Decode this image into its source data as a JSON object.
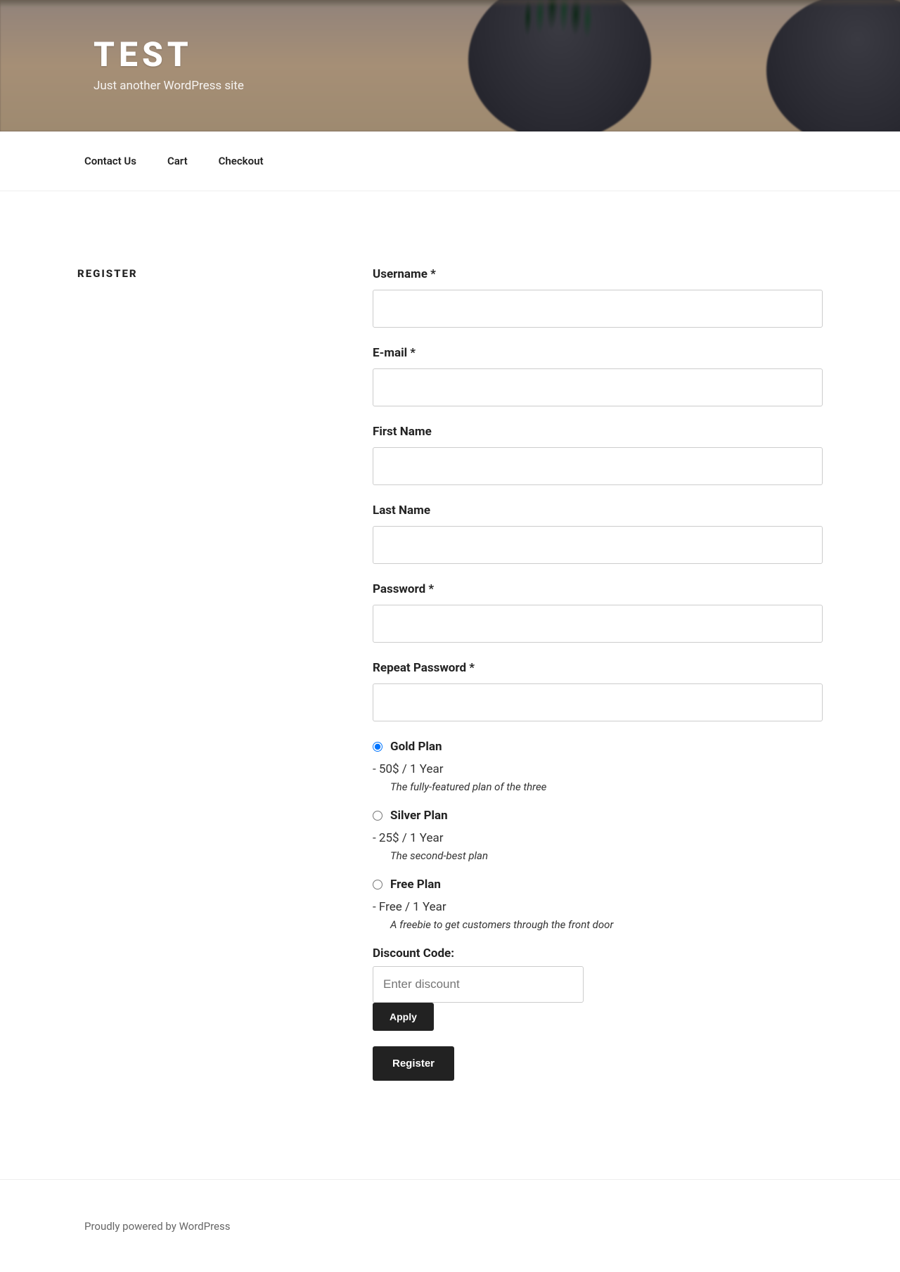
{
  "header": {
    "site_title": "TEST",
    "tagline": "Just another WordPress site"
  },
  "nav": {
    "items": [
      "Contact Us",
      "Cart",
      "Checkout"
    ]
  },
  "page": {
    "title": "REGISTER"
  },
  "form": {
    "username_label": "Username *",
    "email_label": "E-mail *",
    "first_name_label": "First Name",
    "last_name_label": "Last Name",
    "password_label": "Password *",
    "repeat_password_label": "Repeat Password *",
    "discount_label": "Discount Code:",
    "discount_placeholder": "Enter discount",
    "apply_label": "Apply",
    "register_label": "Register"
  },
  "plans": [
    {
      "name": "Gold Plan",
      "price": "- 50$ / 1 Year",
      "desc": "The fully-featured plan of the three",
      "checked": true
    },
    {
      "name": "Silver Plan",
      "price": "- 25$ / 1 Year",
      "desc": "The second-best plan",
      "checked": false
    },
    {
      "name": "Free Plan",
      "price": "- Free / 1 Year",
      "desc": "A freebie to get customers through the front door",
      "checked": false
    }
  ],
  "footer": {
    "text": "Proudly powered by WordPress"
  }
}
